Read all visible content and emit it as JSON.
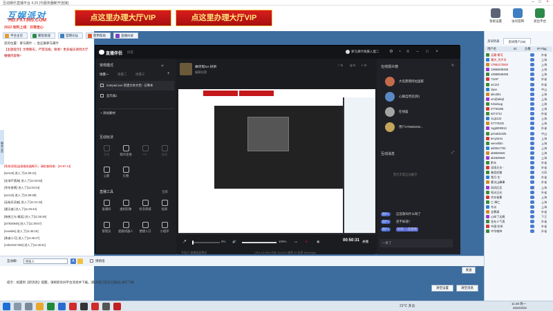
{
  "window": {
    "title": "互动娱乐直播平台 4.20 [与服务器断开连接]"
  },
  "logo": {
    "line1": "互娱派对",
    "line2": "HD.FXT365.COM",
    "line3": "2022 有料上线 · 日常走心"
  },
  "banner": {
    "ad1": "点这里办理大厅VIP",
    "ad2": "点这里办理大厅VIP"
  },
  "topicons": [
    {
      "label": "系统设置"
    },
    {
      "label": "访问官网"
    },
    {
      "label": "退出平台"
    }
  ],
  "nav": {
    "tabs": [
      "平台主页",
      "聚焦频道",
      "官网论坛",
      "使用帮助",
      "直播间录"
    ]
  },
  "location": "您的位置：萝马黄叶 → 坐庄群萝马黄叶",
  "notice": "【主题提示】文明聊天，严禁违规，谢谢！更多娱乐请到大厅",
  "notice2": "播播内容啊~",
  "sideflag": "版本公告",
  "chat": [
    {
      "text": "[系统消息]连接服务器断开，请检查网络：[10.87.14]",
      "red": true
    },
    {
      "text": "[wz123] 进入了[11:05:21]"
    },
    {
      "text": "[花海不落海] 进入了[11:03:52]"
    },
    {
      "text": "[京东香蕉] 进入了[11:04:04]"
    },
    {
      "text": "[wz123] 进入了[11:06:09]"
    },
    {
      "text": "[无敌灵语者] 进入了[11:21:32]"
    },
    {
      "text": "[遇见者] 进入了[11:26:44]"
    },
    {
      "text": "[暗夜之光·精英] 进入了[11:36:49]"
    },
    {
      "text": "[ai7826946] 进入了[11:39:57]"
    },
    {
      "text": "[newskin] 进入了[11:46:16]"
    },
    {
      "text": "[勇者小可] 进入了[11:46:27]"
    },
    {
      "text": "[13510447465] 进入了[11:46:31]"
    }
  ],
  "inputbar": {
    "label": "互动聊：",
    "select": "所有人",
    "checkbox_label": "悄悄话"
  },
  "send_label": "发送",
  "tip": "提示：如遇到【新消息】提醒，请刷新房间平台消息并下载。[聊天窗口首页已满员] 进行下载",
  "buttons": {
    "b1": "清空设置",
    "b2": "清空消息"
  },
  "right": {
    "tabs": [
      "房间列表",
      "房间用户(36)"
    ],
    "header": {
      "c1": "用户名",
      "c2": "ID",
      "c3": "头像",
      "c4": "IP Flag"
    },
    "users": [
      {
        "name": "无赖·斯可",
        "loc": "外省"
      },
      {
        "name": "潮汐_为不羊",
        "loc": "上海"
      },
      {
        "name": "17991172048",
        "loc": "上海"
      },
      {
        "name": "13866849468",
        "loc": "上海"
      },
      {
        "name": "13996848458",
        "loc": "上海"
      },
      {
        "name": "71197",
        "loc": "外省"
      },
      {
        "name": "wz123",
        "loc": "外省"
      },
      {
        "name": "xlyxx",
        "loc": "中山"
      },
      {
        "name": "aleo001",
        "loc": "上海"
      },
      {
        "name": "om@abisjl",
        "loc": "上海"
      },
      {
        "name": "Kimelaug",
        "loc": "上海"
      },
      {
        "name": "07702455",
        "loc": "上海"
      },
      {
        "name": "6374712",
        "loc": "外省"
      },
      {
        "name": "1cg1122",
        "loc": "上海"
      },
      {
        "name": "lz7770430",
        "loc": "上海"
      },
      {
        "name": "1qg5000913",
        "loc": "外省"
      },
      {
        "name": "prina911025",
        "loc": "中山"
      },
      {
        "name": "tenyranru",
        "loc": "上海"
      },
      {
        "name": "wenehbin",
        "loc": "上海"
      },
      {
        "name": "ai05517703",
        "loc": "上海"
      },
      {
        "name": "ab8826946",
        "loc": "上海"
      },
      {
        "name": "ab2926946",
        "loc": "上海"
      },
      {
        "name": "黔东",
        "loc": "外省"
      },
      {
        "name": "深雨天光··",
        "loc": "外省"
      },
      {
        "name": "美容优雅",
        "loc": "大同"
      },
      {
        "name": "雪月·生·",
        "loc": "外省"
      },
      {
        "name": "夏光山峰事",
        "loc": "外省"
      },
      {
        "name": "凤风后至",
        "loc": "上海"
      },
      {
        "name": "阳光日光",
        "loc": "外省"
      },
      {
        "name": "京东香蕉",
        "loc": "上海"
      },
      {
        "name": "亡·瞬亡",
        "loc": "上海"
      },
      {
        "name": "冬瓜",
        "loc": "上海"
      },
      {
        "name": "会慕清",
        "loc": "外省"
      },
      {
        "name": "心碎了无痕",
        "loc": "下正"
      },
      {
        "name": "金在人气男",
        "loc": "外省"
      },
      {
        "name": "中国·秒杀",
        "loc": "外省"
      },
      {
        "name": "中华物种",
        "loc": "外省"
      }
    ]
  },
  "obs": {
    "title": "直播伴侣",
    "subtitle": "抖音",
    "user": "萝马黄叶微属入着二",
    "scene_mode": "常规模式",
    "scenes": [
      "场景一",
      "场景二",
      "场景三"
    ],
    "add_label": "添加",
    "sources": [
      {
        "name": "notepad.exe 新建文本文档 - 记事本"
      },
      {
        "name": "显示器1"
      }
    ],
    "add_source": "+ 添加素材",
    "interact": "互动玩法",
    "interact_items": [
      "连线",
      "观众连线",
      "PK",
      "福袋",
      "心愿",
      "礼物"
    ],
    "tools": "直播工具",
    "tools_more": "全部",
    "tool_items": [
      "直播间",
      "虚拟形象",
      "抖音商城",
      "投屏",
      "管理员",
      "超级机器人",
      "便捷入口",
      "小程序"
    ],
    "stream_title": "缘尽阿SA 好听",
    "stream_sub": "编辑标题",
    "stats": [
      "5",
      "0",
      "0"
    ],
    "volume1": "0%",
    "volume2": "100%",
    "time": "00:50:31",
    "stop": "关播",
    "perf": "CPU 10.98%   内存 40.61%   帧率 30   码率 8940kbps",
    "perf_hint": "不显示 直播画面预览",
    "audience_title": "在线观众榜",
    "viewers": [
      {
        "name": "大名鼎鼎阿拉国家"
      },
      {
        "name": "心静自然凉(阿)"
      },
      {
        "name": "在线猫"
      },
      {
        "name": "用户276550294..."
      }
    ],
    "messages_title": "互动消息",
    "empty_hint": "暂无丰富互动展示",
    "msgs": [
      {
        "name": "用户1",
        "text": "这首歌叫什么呀了"
      },
      {
        "name": "用户2",
        "text": "还不知道！"
      },
      {
        "name": "用户3",
        "text": "好的 一首歌吧"
      }
    ],
    "reply_placeholder": "一条了"
  },
  "taskbar": {
    "weather": "21°C 多云",
    "time": "11:48 周一",
    "date": "2022/3/22"
  }
}
